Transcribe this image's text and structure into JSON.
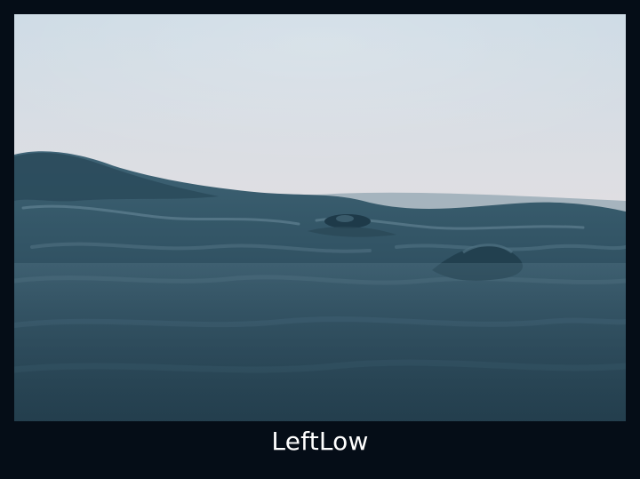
{
  "photo": {
    "subject": "ocean-wave-at-dusk",
    "colors": {
      "sky_top": "#cfdde6",
      "sky_bottom": "#ecd9d3",
      "water_light": "#4d6f80",
      "water_mid": "#2f5062",
      "water_dark": "#1a3342"
    }
  },
  "caption": {
    "text": "LeftLow"
  }
}
